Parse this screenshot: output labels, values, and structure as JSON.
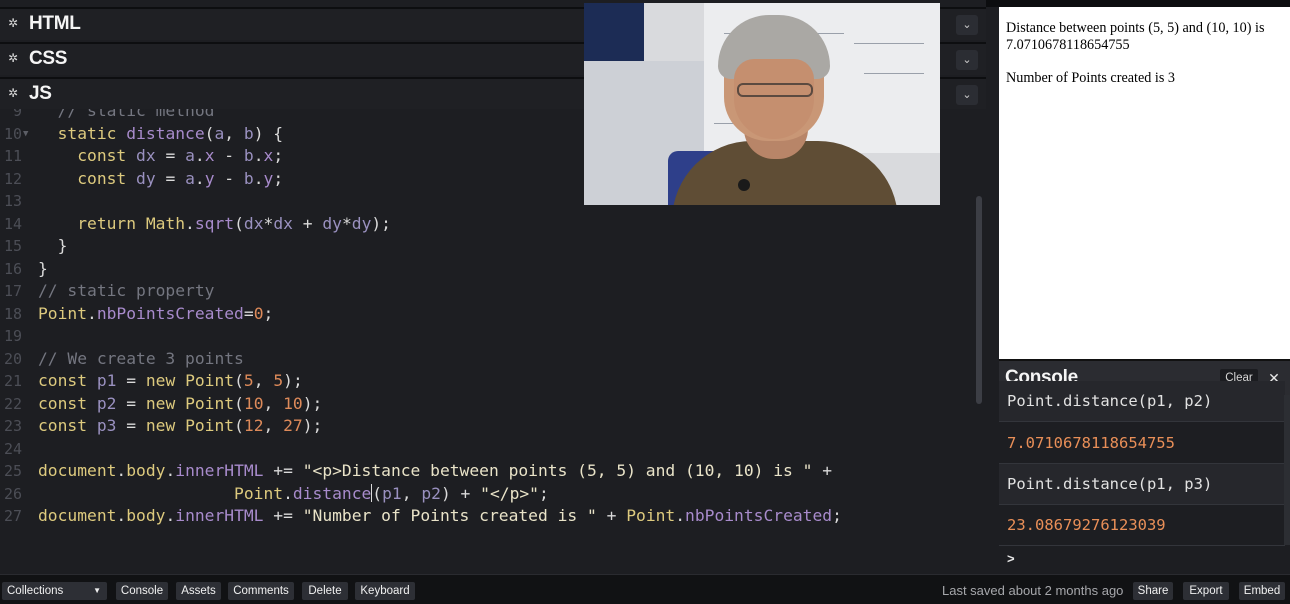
{
  "panels": {
    "html_title": "HTML",
    "css_title": "CSS",
    "js_title": "JS"
  },
  "code_lines": [
    {
      "n": "9",
      "tokens": [
        [
          "c",
          "  // static method"
        ]
      ]
    },
    {
      "n": "10",
      "fold": true,
      "tokens": [
        [
          "k",
          "  static "
        ],
        [
          "f",
          "distance"
        ],
        [
          "o",
          "("
        ],
        [
          "v",
          "a"
        ],
        [
          "o",
          ", "
        ],
        [
          "v",
          "b"
        ],
        [
          "o",
          ") {"
        ]
      ]
    },
    {
      "n": "11",
      "tokens": [
        [
          "k",
          "    const "
        ],
        [
          "v",
          "dx"
        ],
        [
          "o",
          " = "
        ],
        [
          "v",
          "a"
        ],
        [
          "o",
          "."
        ],
        [
          "f",
          "x"
        ],
        [
          "o",
          " - "
        ],
        [
          "v",
          "b"
        ],
        [
          "o",
          "."
        ],
        [
          "f",
          "x"
        ],
        [
          "o",
          ";"
        ]
      ]
    },
    {
      "n": "12",
      "tokens": [
        [
          "k",
          "    const "
        ],
        [
          "v",
          "dy"
        ],
        [
          "o",
          " = "
        ],
        [
          "v",
          "a"
        ],
        [
          "o",
          "."
        ],
        [
          "f",
          "y"
        ],
        [
          "o",
          " - "
        ],
        [
          "v",
          "b"
        ],
        [
          "o",
          "."
        ],
        [
          "f",
          "y"
        ],
        [
          "o",
          ";"
        ]
      ]
    },
    {
      "n": "13",
      "tokens": []
    },
    {
      "n": "14",
      "tokens": [
        [
          "k",
          "    return "
        ],
        [
          "k",
          "Math"
        ],
        [
          "o",
          "."
        ],
        [
          "f",
          "sqrt"
        ],
        [
          "o",
          "("
        ],
        [
          "v",
          "dx"
        ],
        [
          "o",
          "*"
        ],
        [
          "v",
          "dx"
        ],
        [
          "o",
          " + "
        ],
        [
          "v",
          "dy"
        ],
        [
          "o",
          "*"
        ],
        [
          "v",
          "dy"
        ],
        [
          "o",
          ");"
        ]
      ]
    },
    {
      "n": "15",
      "tokens": [
        [
          "o",
          "  }"
        ]
      ]
    },
    {
      "n": "16",
      "tokens": [
        [
          "o",
          "}"
        ]
      ]
    },
    {
      "n": "17",
      "tokens": [
        [
          "c",
          "// static property"
        ]
      ]
    },
    {
      "n": "18",
      "tokens": [
        [
          "k",
          "Point"
        ],
        [
          "o",
          "."
        ],
        [
          "f",
          "nbPointsCreated"
        ],
        [
          "o",
          "="
        ],
        [
          "n",
          "0"
        ],
        [
          "o",
          ";"
        ]
      ]
    },
    {
      "n": "19",
      "tokens": []
    },
    {
      "n": "20",
      "tokens": [
        [
          "c",
          "// We create 3 points"
        ]
      ]
    },
    {
      "n": "21",
      "tokens": [
        [
          "k",
          "const "
        ],
        [
          "v",
          "p1"
        ],
        [
          "o",
          " = "
        ],
        [
          "k",
          "new "
        ],
        [
          "k",
          "Point"
        ],
        [
          "o",
          "("
        ],
        [
          "n",
          "5"
        ],
        [
          "o",
          ", "
        ],
        [
          "n",
          "5"
        ],
        [
          "o",
          ");"
        ]
      ]
    },
    {
      "n": "22",
      "tokens": [
        [
          "k",
          "const "
        ],
        [
          "v",
          "p2"
        ],
        [
          "o",
          " = "
        ],
        [
          "k",
          "new "
        ],
        [
          "k",
          "Point"
        ],
        [
          "o",
          "("
        ],
        [
          "n",
          "10"
        ],
        [
          "o",
          ", "
        ],
        [
          "n",
          "10"
        ],
        [
          "o",
          ");"
        ]
      ]
    },
    {
      "n": "23",
      "tokens": [
        [
          "k",
          "const "
        ],
        [
          "v",
          "p3"
        ],
        [
          "o",
          " = "
        ],
        [
          "k",
          "new "
        ],
        [
          "k",
          "Point"
        ],
        [
          "o",
          "("
        ],
        [
          "n",
          "12"
        ],
        [
          "o",
          ", "
        ],
        [
          "n",
          "27"
        ],
        [
          "o",
          ");"
        ]
      ]
    },
    {
      "n": "24",
      "tokens": []
    },
    {
      "n": "25",
      "tokens": [
        [
          "k",
          "document"
        ],
        [
          "o",
          "."
        ],
        [
          "k",
          "body"
        ],
        [
          "o",
          "."
        ],
        [
          "f",
          "innerHTML"
        ],
        [
          "o",
          " += "
        ],
        [
          "s",
          "\"<p>Distance between points (5, 5) and (10, 10) is \""
        ],
        [
          "o",
          " +"
        ]
      ]
    },
    {
      "n": "26",
      "tokens": [
        [
          "o",
          "                    "
        ],
        [
          "k",
          "Point"
        ],
        [
          "o",
          "."
        ],
        [
          "f",
          "distance"
        ],
        [
          "cursor",
          ""
        ],
        [
          "o",
          "("
        ],
        [
          "v",
          "p1"
        ],
        [
          "o",
          ", "
        ],
        [
          "v",
          "p2"
        ],
        [
          "o",
          ") + "
        ],
        [
          "s",
          "\"</p>\""
        ],
        [
          "o",
          ";"
        ]
      ]
    },
    {
      "n": "27",
      "tokens": [
        [
          "k",
          "document"
        ],
        [
          "o",
          "."
        ],
        [
          "k",
          "body"
        ],
        [
          "o",
          "."
        ],
        [
          "f",
          "innerHTML"
        ],
        [
          "o",
          " += "
        ],
        [
          "s",
          "\"Number of Points created is \""
        ],
        [
          "o",
          " + "
        ],
        [
          "k",
          "Point"
        ],
        [
          "o",
          "."
        ],
        [
          "f",
          "nbPointsCreated"
        ],
        [
          "o",
          ";"
        ]
      ]
    }
  ],
  "preview": {
    "line1": "Distance between points (5, 5) and (10, 10) is 7.0710678118654755",
    "line2": "Number of Points created is 3"
  },
  "console": {
    "title": "Console",
    "clear_label": "Clear",
    "entries": [
      {
        "kind": "in",
        "text": "Point.distance(p1, p2)"
      },
      {
        "kind": "out",
        "text": "7.0710678118654755"
      },
      {
        "kind": "in",
        "text": "Point.distance(p1, p3)"
      },
      {
        "kind": "out",
        "text": "23.08679276123039"
      }
    ],
    "prompt": ">"
  },
  "footer": {
    "collections_label": "Collections",
    "console_label": "Console",
    "assets_label": "Assets",
    "comments_label": "Comments",
    "delete_label": "Delete",
    "keyboard_label": "Keyboard",
    "saved_text": "Last saved about 2 months ago",
    "share_label": "Share",
    "export_label": "Export",
    "embed_label": "Embed"
  },
  "icons": {
    "panel_settings": "gear-icon",
    "panel_collapse": "chevron-down-icon",
    "console_close": "close-icon"
  }
}
